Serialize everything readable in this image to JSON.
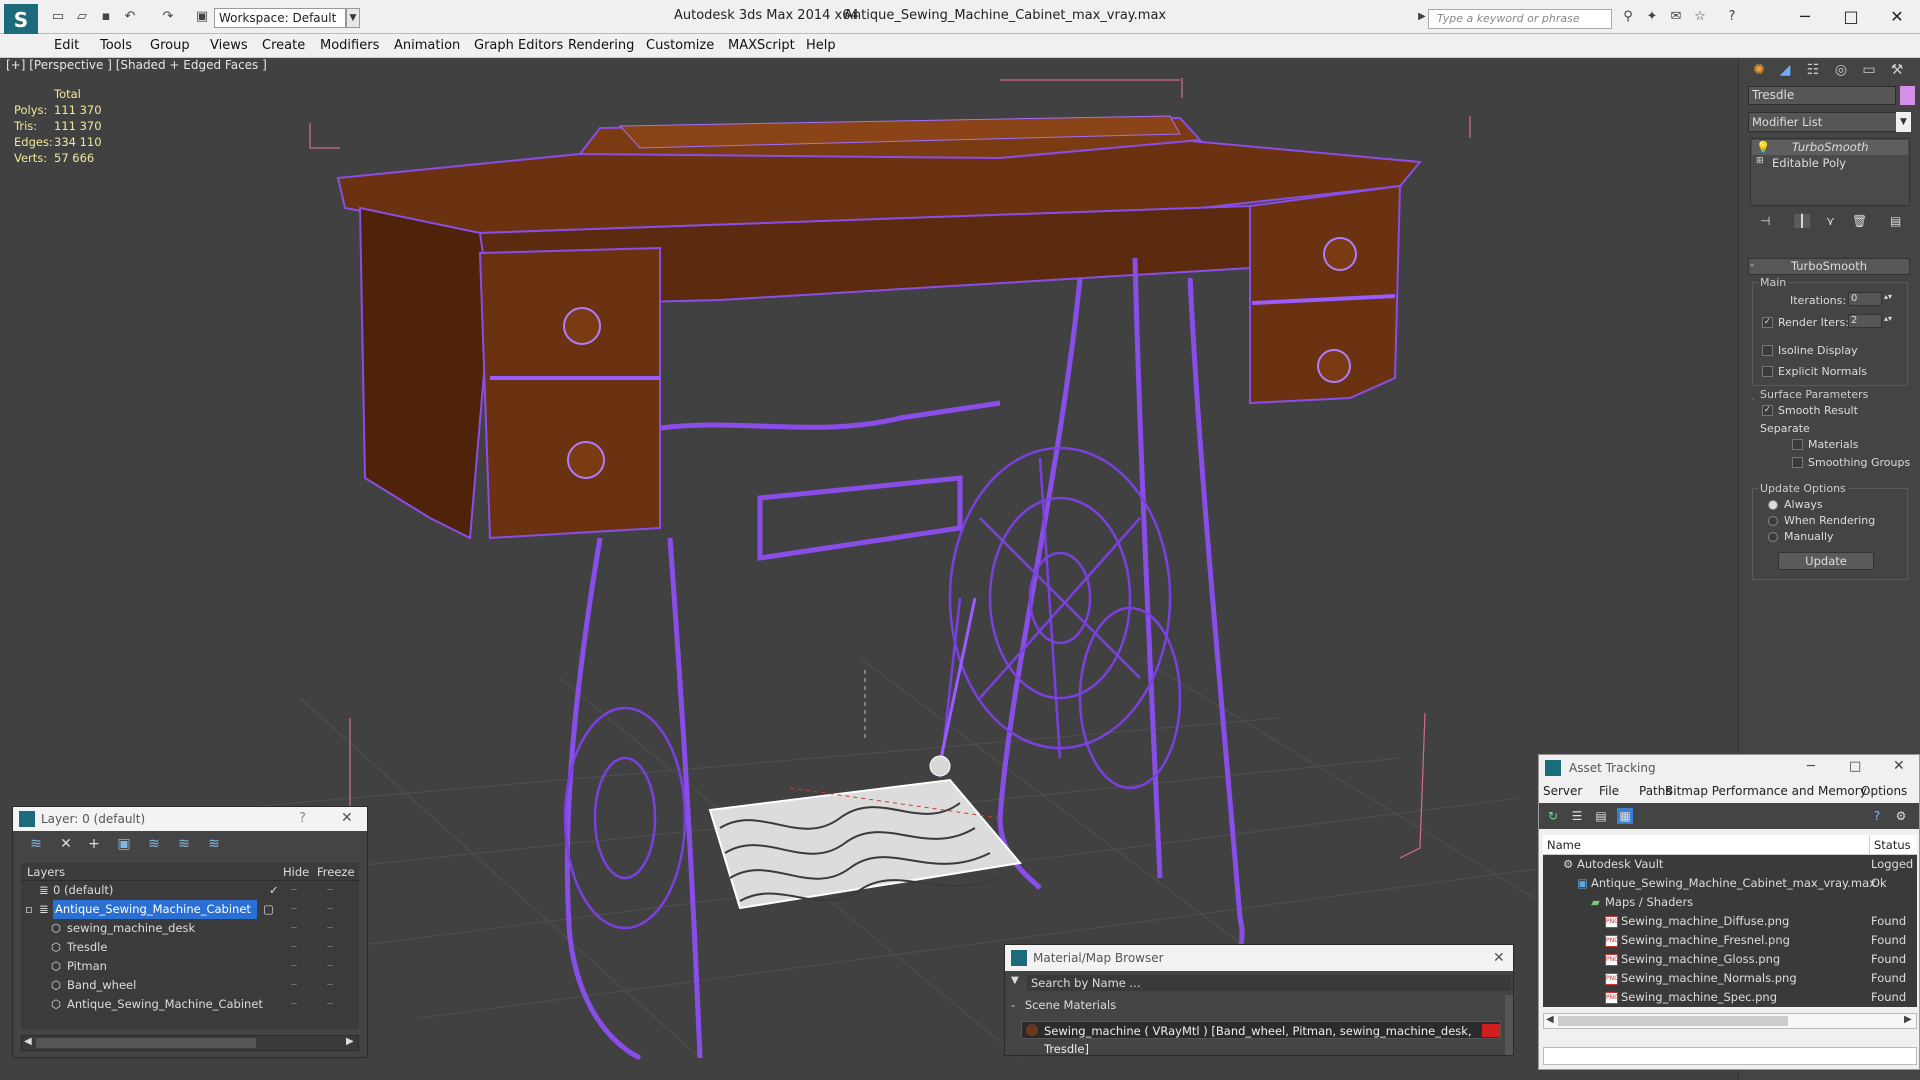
{
  "titlebar": {
    "app_title": "Autodesk 3ds Max  2014 x64",
    "file_title": "Antique_Sewing_Machine_Cabinet_max_vray.max",
    "workspace": "Workspace: Default",
    "search_placeholder": "Type a keyword or phrase"
  },
  "menus": [
    "Edit",
    "Tools",
    "Group",
    "Views",
    "Create",
    "Modifiers",
    "Animation",
    "Graph Editors",
    "Rendering",
    "Customize",
    "MAXScript",
    "Help"
  ],
  "viewport": {
    "label": "[+] [Perspective ] [Shaded + Edged Faces ]",
    "stats": {
      "total_label": "Total",
      "polys_label": "Polys:",
      "polys": "111 370",
      "tris_label": "Tris:",
      "tris": "111 370",
      "edges_label": "Edges:",
      "edges": "334 110",
      "verts_label": "Verts:",
      "verts": "57 666"
    }
  },
  "command_panel": {
    "object_name": "Tresdle",
    "object_color": "#d690e8",
    "modifier_list": "Modifier List",
    "stack": [
      "TurboSmooth",
      "Editable Poly"
    ],
    "rollout": "TurboSmooth",
    "main_group": "Main",
    "iterations_label": "Iterations:",
    "iterations": "0",
    "render_iters_label": "Render Iters:",
    "render_iters": "2",
    "isoline": "Isoline Display",
    "explicit_normals": "Explicit Normals",
    "surface_group": "Surface Parameters",
    "smooth_result": "Smooth Result",
    "separate": "Separate",
    "materials": "Materials",
    "smoothing_groups": "Smoothing Groups",
    "update_group": "Update Options",
    "always": "Always",
    "when_rendering": "When Rendering",
    "manually": "Manually",
    "update_btn": "Update"
  },
  "layer_window": {
    "title": "Layer: 0 (default)",
    "help": "?",
    "col_layers": "Layers",
    "col_hide": "Hide",
    "col_freeze": "Freeze",
    "rows": [
      {
        "name": "0 (default)",
        "indent": 1
      },
      {
        "name": "Antique_Sewing_Machine_Cabinet",
        "indent": 1
      },
      {
        "name": "sewing_machine_desk",
        "indent": 2
      },
      {
        "name": "Tresdle",
        "indent": 2
      },
      {
        "name": "Pitman",
        "indent": 2
      },
      {
        "name": "Band_wheel",
        "indent": 2
      },
      {
        "name": "Antique_Sewing_Machine_Cabinet",
        "indent": 2
      }
    ]
  },
  "material_browser": {
    "title": "Material/Map Browser",
    "search": "Search by Name ...",
    "section": "Scene Materials",
    "item": "Sewing_machine  ( VRayMtl )  [Band_wheel, Pitman, sewing_machine_desk, Tresdle]",
    "swatch_color": "#cf1f1f"
  },
  "asset_tracking": {
    "title": "Asset Tracking",
    "menu": [
      "Server",
      "File",
      "Paths",
      "Bitmap Performance and Memory",
      "Options"
    ],
    "col_name": "Name",
    "col_status": "Status",
    "rows": [
      {
        "name": "Autodesk Vault",
        "status": "Logged"
      },
      {
        "name": "Antique_Sewing_Machine_Cabinet_max_vray.max",
        "status": "Ok"
      },
      {
        "name": "Maps / Shaders",
        "status": ""
      },
      {
        "name": "Sewing_machine_Diffuse.png",
        "status": "Found"
      },
      {
        "name": "Sewing_machine_Fresnel.png",
        "status": "Found"
      },
      {
        "name": "Sewing_machine_Gloss.png",
        "status": "Found"
      },
      {
        "name": "Sewing_machine_Normals.png",
        "status": "Found"
      },
      {
        "name": "Sewing_machine_Spec.png",
        "status": "Found"
      }
    ]
  }
}
